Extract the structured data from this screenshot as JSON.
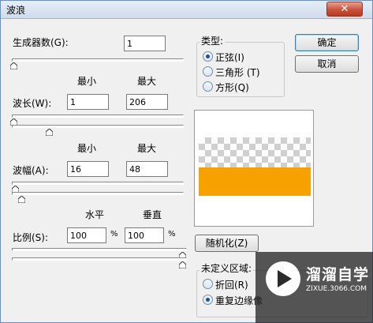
{
  "window": {
    "title": "波浪",
    "close_glyph": "✕"
  },
  "generators": {
    "label": "生成器数(G):",
    "value": "1"
  },
  "headers": {
    "min": "最小",
    "max": "最大",
    "horizontal": "水平",
    "vertical": "垂直"
  },
  "wavelength": {
    "label": "波长(W):",
    "min": "1",
    "max": "206"
  },
  "amplitude": {
    "label": "波幅(A):",
    "min": "16",
    "max": "48"
  },
  "scale": {
    "label": "比例(S):",
    "horizontal": "100",
    "vertical": "100",
    "unit": "%"
  },
  "type": {
    "label": "类型:",
    "options": [
      {
        "label": "正弦(I)",
        "selected": true
      },
      {
        "label": "三角形 (T)",
        "selected": false
      },
      {
        "label": "方形(Q)",
        "selected": false
      }
    ]
  },
  "buttons": {
    "ok": "确定",
    "cancel": "取消",
    "randomize": "随机化(Z)"
  },
  "undefined_area": {
    "label": "未定义区域:",
    "options": [
      {
        "label": "折回(R)",
        "selected": false
      },
      {
        "label": "重复边缘像",
        "selected": true
      }
    ]
  },
  "watermark": {
    "brand": "溜溜自学",
    "url": "ZIXUE.3066.COM"
  }
}
